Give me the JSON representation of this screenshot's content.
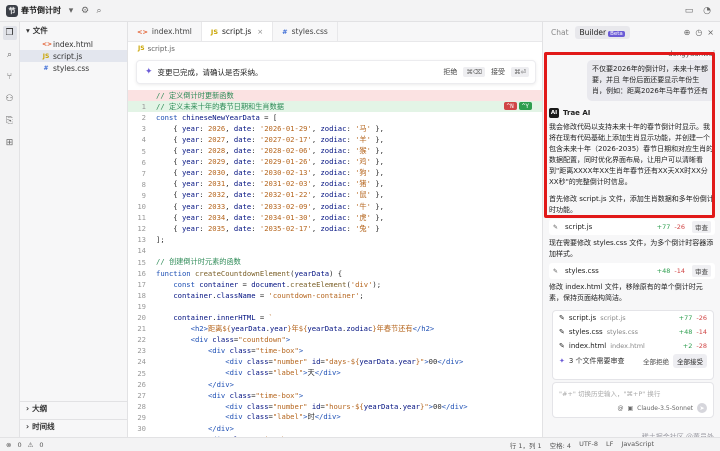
{
  "titlebar": {
    "project": "春节倒计时",
    "project_icon": "节",
    "icons": [
      "chevron-down-icon",
      "gear-icon",
      "search-icon"
    ],
    "right_icons": [
      "layout-icon",
      "account-icon"
    ]
  },
  "sidebar": {
    "header": "文件",
    "files": [
      {
        "name": "index.html",
        "icon": "<>",
        "color": "#e25c2c"
      },
      {
        "name": "script.js",
        "icon": "JS",
        "color": "#c9a400"
      },
      {
        "name": "styles.css",
        "icon": "#",
        "color": "#3b6bd6"
      }
    ],
    "outline": "大纲",
    "timeline": "时间线"
  },
  "tabs": [
    {
      "label": "index.html",
      "icon": "<>",
      "color": "#e25c2c"
    },
    {
      "label": "script.js",
      "icon": "JS",
      "color": "#c9a400"
    },
    {
      "label": "styles.css",
      "icon": "#",
      "color": "#3b6bd6"
    }
  ],
  "breadcrumb": "script.js",
  "notice": {
    "text": "变更已完成，请确认是否采纳。",
    "reject": "拒绝",
    "reject_key": "⌘⌫",
    "accept": "接受",
    "accept_key": "⌘⏎"
  },
  "diff_buttons": {
    "reject": "^N",
    "accept": "^Y"
  },
  "code_lines": [
    {
      "ln": "",
      "kind": "del",
      "html": "<span class='com'>// 定义倒计时更新函数</span>"
    },
    {
      "ln": "1",
      "kind": "add",
      "html": "<span class='com'>// 定义未来十年的春节日期和生肖数据</span>"
    },
    {
      "ln": "2",
      "kind": "add",
      "html": "<span class='kw'>const</span> <span class='var'>chineseNewYearData</span> = ["
    },
    {
      "ln": "3",
      "kind": "add",
      "html": "    { <span class='var'>year</span>: <span class='str'>2026</span>, <span class='var'>date</span>: <span class='str'>'2026-01-29'</span>, <span class='var'>zodiac</span>: <span class='str'>'马'</span> },"
    },
    {
      "ln": "4",
      "kind": "add",
      "html": "    { <span class='var'>year</span>: <span class='str'>2027</span>, <span class='var'>date</span>: <span class='str'>'2027-02-17'</span>, <span class='var'>zodiac</span>: <span class='str'>'羊'</span> },"
    },
    {
      "ln": "5",
      "kind": "add",
      "html": "    { <span class='var'>year</span>: <span class='str'>2028</span>, <span class='var'>date</span>: <span class='str'>'2028-02-06'</span>, <span class='var'>zodiac</span>: <span class='str'>'猴'</span> },"
    },
    {
      "ln": "6",
      "kind": "add",
      "html": "    { <span class='var'>year</span>: <span class='str'>2029</span>, <span class='var'>date</span>: <span class='str'>'2029-01-26'</span>, <span class='var'>zodiac</span>: <span class='str'>'鸡'</span> },"
    },
    {
      "ln": "7",
      "kind": "add",
      "html": "    { <span class='var'>year</span>: <span class='str'>2030</span>, <span class='var'>date</span>: <span class='str'>'2030-02-13'</span>, <span class='var'>zodiac</span>: <span class='str'>'狗'</span> },"
    },
    {
      "ln": "8",
      "kind": "add",
      "html": "    { <span class='var'>year</span>: <span class='str'>2031</span>, <span class='var'>date</span>: <span class='str'>'2031-02-03'</span>, <span class='var'>zodiac</span>: <span class='str'>'猪'</span> },"
    },
    {
      "ln": "9",
      "kind": "add",
      "html": "    { <span class='var'>year</span>: <span class='str'>2032</span>, <span class='var'>date</span>: <span class='str'>'2032-01-22'</span>, <span class='var'>zodiac</span>: <span class='str'>'鼠'</span> },"
    },
    {
      "ln": "10",
      "kind": "add",
      "html": "    { <span class='var'>year</span>: <span class='str'>2033</span>, <span class='var'>date</span>: <span class='str'>'2033-02-09'</span>, <span class='var'>zodiac</span>: <span class='str'>'牛'</span> },"
    },
    {
      "ln": "11",
      "kind": "add",
      "html": "    { <span class='var'>year</span>: <span class='str'>2034</span>, <span class='var'>date</span>: <span class='str'>'2034-01-30'</span>, <span class='var'>zodiac</span>: <span class='str'>'虎'</span> },"
    },
    {
      "ln": "12",
      "kind": "add",
      "html": "    { <span class='var'>year</span>: <span class='str'>2035</span>, <span class='var'>date</span>: <span class='str'>'2035-02-17'</span>, <span class='var'>zodiac</span>: <span class='str'>'兔'</span> }"
    },
    {
      "ln": "13",
      "kind": "add",
      "html": "];"
    },
    {
      "ln": "14",
      "kind": "add",
      "html": ""
    },
    {
      "ln": "15",
      "kind": "add",
      "html": "<span class='com'>// 创建倒计时元素的函数</span>"
    },
    {
      "ln": "16",
      "kind": "add",
      "html": "<span class='kw'>function</span> <span class='fn'>createCountdownElement</span>(<span class='var'>yearData</span>) {"
    },
    {
      "ln": "17",
      "kind": "add",
      "html": "    <span class='kw'>const</span> <span class='var'>container</span> = <span class='var'>document</span>.<span class='fn'>createElement</span>(<span class='str'>'div'</span>);"
    },
    {
      "ln": "18",
      "kind": "add",
      "html": "    <span class='var'>container</span>.<span class='var'>className</span> = <span class='str'>'countdown-container'</span>;"
    },
    {
      "ln": "19",
      "kind": "add",
      "html": ""
    },
    {
      "ln": "20",
      "kind": "add",
      "html": "    <span class='var'>container</span>.<span class='var'>innerHTML</span> = <span class='str'>`</span>"
    },
    {
      "ln": "21",
      "kind": "add",
      "html": "        <span class='tag'>&lt;h2&gt;</span><span class='str'>距离${</span><span class='var'>yearData</span>.<span class='var'>year</span><span class='str'>}年${</span><span class='var'>yearData</span>.<span class='var'>zodiac</span><span class='str'>}年春节还有</span><span class='tag'>&lt;/h2&gt;</span>"
    },
    {
      "ln": "22",
      "kind": "add",
      "html": "        <span class='tag'>&lt;div</span> <span class='var'>class</span>=<span class='str'>\"countdown\"</span><span class='tag'>&gt;</span>"
    },
    {
      "ln": "23",
      "kind": "add",
      "html": "            <span class='tag'>&lt;div</span> <span class='var'>class</span>=<span class='str'>\"time-box\"</span><span class='tag'>&gt;</span>"
    },
    {
      "ln": "24",
      "kind": "add",
      "html": "                <span class='tag'>&lt;div</span> <span class='var'>class</span>=<span class='str'>\"number\"</span> <span class='var'>id</span>=<span class='str'>\"days-${</span><span class='var'>yearData</span>.<span class='var'>year</span><span class='str'>}\"</span><span class='tag'>&gt;</span>00<span class='tag'>&lt;/div&gt;</span>"
    },
    {
      "ln": "25",
      "kind": "add",
      "html": "                <span class='tag'>&lt;div</span> <span class='var'>class</span>=<span class='str'>\"label\"</span><span class='tag'>&gt;</span>天<span class='tag'>&lt;/div&gt;</span>"
    },
    {
      "ln": "26",
      "kind": "add",
      "html": "            <span class='tag'>&lt;/div&gt;</span>"
    },
    {
      "ln": "27",
      "kind": "add",
      "html": "            <span class='tag'>&lt;div</span> <span class='var'>class</span>=<span class='str'>\"time-box\"</span><span class='tag'>&gt;</span>"
    },
    {
      "ln": "28",
      "kind": "add",
      "html": "                <span class='tag'>&lt;div</span> <span class='var'>class</span>=<span class='str'>\"number\"</span> <span class='var'>id</span>=<span class='str'>\"hours-${</span><span class='var'>yearData</span>.<span class='var'>year</span><span class='str'>}\"</span><span class='tag'>&gt;</span>00<span class='tag'>&lt;/div&gt;</span>"
    },
    {
      "ln": "29",
      "kind": "add",
      "html": "                <span class='tag'>&lt;div</span> <span class='var'>class</span>=<span class='str'>\"label\"</span><span class='tag'>&gt;</span>时<span class='tag'>&lt;/div&gt;</span>"
    },
    {
      "ln": "30",
      "kind": "add",
      "html": "            <span class='tag'>&lt;/div&gt;</span>"
    },
    {
      "ln": "31",
      "kind": "add",
      "html": "            <span class='tag'>&lt;div</span> <span class='var'>class</span>=<span class='str'>\"time-box\"</span><span class='tag'>&gt;</span>"
    }
  ],
  "panel": {
    "tab_chat": "Chat",
    "tab_builder": "Builder",
    "beta": "Beta",
    "user_name": "dongyuanwai",
    "user_message": "不仅要2026年的倒计时，未来十年都要，并且 年份后面还要显示年份生肖，例如：距离2026年马年春节还有",
    "ai_name": "Trae AI",
    "ai_avatar": "AI",
    "ai_message": "我会修改代码以支持未来十年的春节倒计时显示。我将在现有代码基础上添加生肖显示功能，并创建一个包含未来十年（2026-2035）春节日期和对应生肖的数据配置，同时优化界面布局，让用户可以清晰看到\"距离XXXX年XX生肖年春节还有XX天XX时XX分XX秒\"的完整倒计时信息。",
    "step1": "首先修改 script.js 文件，添加生肖数据和多年份倒计时功能。",
    "chip1": {
      "name": "script.js",
      "add": "+77",
      "del": "-26",
      "review": "审查"
    },
    "step2": "现在需要修改 styles.css 文件，为多个倒计时容器添加样式。",
    "chip2": {
      "name": "styles.css",
      "add": "+48",
      "del": "-14",
      "review": "审查"
    },
    "step3": "修改 index.html 文件，移除原有的单个倒计时元素，保持页面结构简洁。"
  },
  "review": {
    "rows": [
      {
        "name": "script.js",
        "sub": "script.js",
        "add": "+77",
        "del": "-26"
      },
      {
        "name": "styles.css",
        "sub": "styles.css",
        "add": "+48",
        "del": "-14"
      },
      {
        "name": "index.html",
        "sub": "index.html",
        "add": "+2",
        "del": "-28"
      }
    ],
    "summary": "3 个文件需要审查",
    "reject_all": "全部拒绝",
    "accept_all": "全部接受"
  },
  "input": {
    "placeholder": "\"#+\" 切换历史输入，\"⌘+P\" 换行",
    "model": "Claude-3.5-Sonnet"
  },
  "watermark": "稀土掘金社区 @董员外",
  "statusbar": {
    "errors": "0",
    "warnings": "0",
    "position": "行 1，列 1",
    "spaces": "空格: 4",
    "encoding": "UTF-8",
    "eol": "LF",
    "language": "JavaScript"
  },
  "colors": {
    "highlight": "#e11919",
    "accent": "#6b5bd6",
    "add_green": "#2e9e4f",
    "del_red": "#d04545"
  }
}
